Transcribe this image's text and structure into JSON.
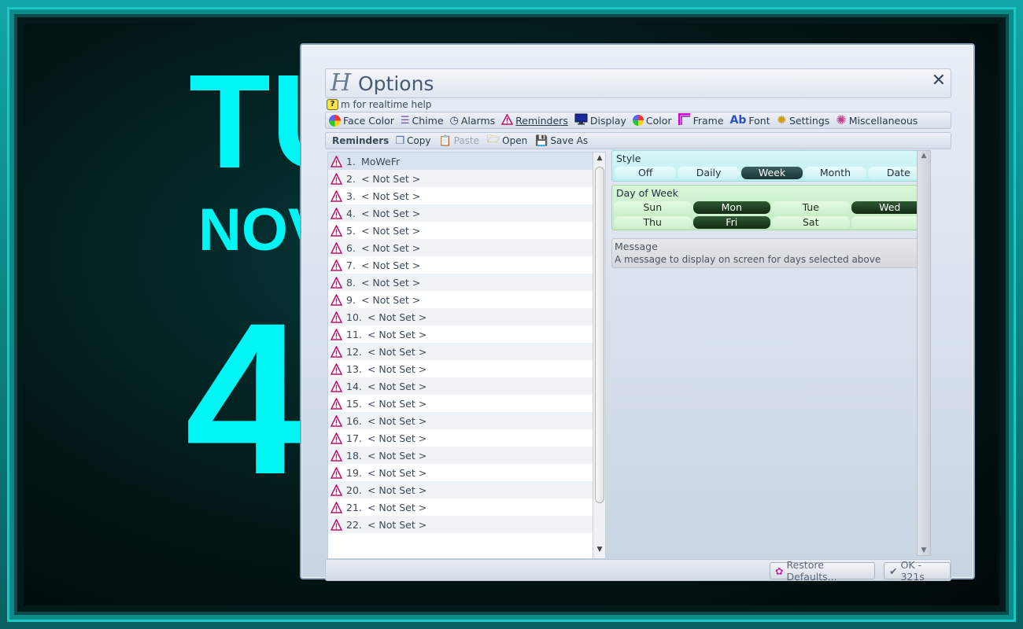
{
  "clock": {
    "day": "TU",
    "month": "NOV",
    "time": "4"
  },
  "dialog": {
    "logo": "H",
    "title": "Options",
    "help_text": "m for realtime help",
    "help_icon_text": "?"
  },
  "tabs": [
    {
      "label": "Face Color",
      "icon": "face-color-pie-icon"
    },
    {
      "label": "Chime",
      "icon": "chime-icon"
    },
    {
      "label": "Alarms",
      "icon": "alarm-clock-icon"
    },
    {
      "label": "Reminders",
      "icon": "warning-triangle-icon",
      "active": true
    },
    {
      "label": "Display",
      "icon": "monitor-icon"
    },
    {
      "label": "Color",
      "icon": "color-pie-icon"
    },
    {
      "label": "Frame",
      "icon": "frame-icon"
    },
    {
      "label": "Font",
      "icon": "font-icon",
      "icon_text": "Ab"
    },
    {
      "label": "Settings",
      "icon": "gear-icon"
    },
    {
      "label": "Miscellaneous",
      "icon": "multi-gear-icon"
    }
  ],
  "toolbar": {
    "title": "Reminders",
    "copy": "Copy",
    "paste": "Paste",
    "open": "Open",
    "save_as": "Save As"
  },
  "reminders": [
    {
      "num": "1.",
      "label": "MoWeFr"
    },
    {
      "num": "2.",
      "label": "< Not Set >"
    },
    {
      "num": "3.",
      "label": "< Not Set >"
    },
    {
      "num": "4.",
      "label": "< Not Set >"
    },
    {
      "num": "5.",
      "label": "< Not Set >"
    },
    {
      "num": "6.",
      "label": "< Not Set >"
    },
    {
      "num": "7.",
      "label": "< Not Set >"
    },
    {
      "num": "8.",
      "label": "< Not Set >"
    },
    {
      "num": "9.",
      "label": "< Not Set >"
    },
    {
      "num": "10.",
      "label": "< Not Set >"
    },
    {
      "num": "11.",
      "label": "< Not Set >"
    },
    {
      "num": "12.",
      "label": "< Not Set >"
    },
    {
      "num": "13.",
      "label": "< Not Set >"
    },
    {
      "num": "14.",
      "label": "< Not Set >"
    },
    {
      "num": "15.",
      "label": "< Not Set >"
    },
    {
      "num": "16.",
      "label": "< Not Set >"
    },
    {
      "num": "17.",
      "label": "< Not Set >"
    },
    {
      "num": "18.",
      "label": "< Not Set >"
    },
    {
      "num": "19.",
      "label": "< Not Set >"
    },
    {
      "num": "20.",
      "label": "< Not Set >"
    },
    {
      "num": "21.",
      "label": "< Not Set >"
    },
    {
      "num": "22.",
      "label": "< Not Set >"
    }
  ],
  "style": {
    "title": "Style",
    "options": [
      "Off",
      "Daily",
      "Week",
      "Month",
      "Date"
    ],
    "selected": "Week"
  },
  "day_of_week": {
    "title": "Day of Week",
    "days": [
      {
        "label": "Sun",
        "on": false
      },
      {
        "label": "Mon",
        "on": true
      },
      {
        "label": "Tue",
        "on": false
      },
      {
        "label": "Wed",
        "on": true
      },
      {
        "label": "Thu",
        "on": false
      },
      {
        "label": "Fri",
        "on": true
      },
      {
        "label": "Sat",
        "on": false
      }
    ]
  },
  "message": {
    "label": "Message",
    "placeholder": "A message to display on screen for days selected above"
  },
  "buttons": {
    "restore": "Restore Defaults...",
    "ok": "OK - 321s"
  },
  "colors": {
    "clock_text": "#00f5f5",
    "warning_icon": "#c0106a",
    "style_on": "#173535",
    "day_on": "#112a13"
  }
}
